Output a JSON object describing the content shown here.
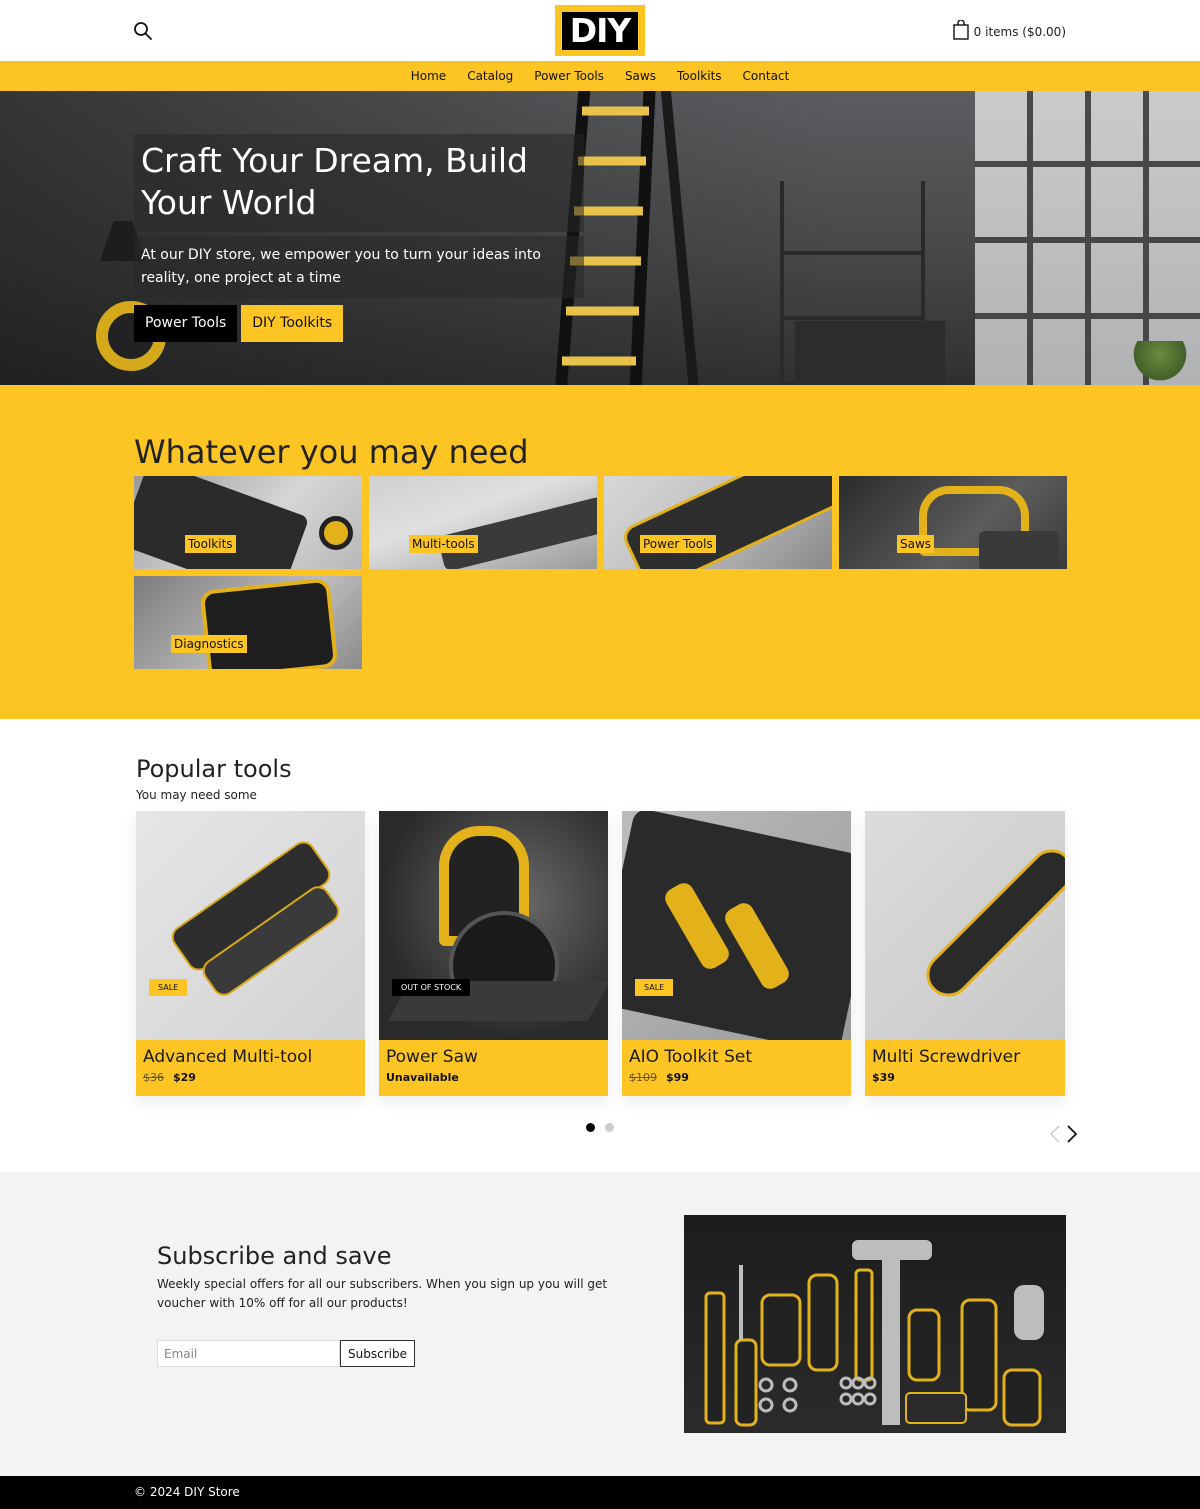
{
  "header": {
    "logo_text": "DIY",
    "search_icon": "search-icon",
    "cart_icon": "shopping-bag-icon",
    "cart_label": "0 items ($0.00)"
  },
  "nav": {
    "items": [
      {
        "label": "Home"
      },
      {
        "label": "Catalog"
      },
      {
        "label": "Power Tools"
      },
      {
        "label": "Saws"
      },
      {
        "label": "Toolkits"
      },
      {
        "label": "Contact"
      }
    ]
  },
  "hero": {
    "title": "Craft Your Dream, Build Your World",
    "subtitle": "At our DIY store, we empower you to turn your ideas into reality, one project at a time",
    "primary_button": "Power Tools",
    "secondary_button": "DIY Toolkits"
  },
  "categories": {
    "title": "Whatever you may need",
    "items": [
      {
        "label": "Toolkits"
      },
      {
        "label": "Multi-tools"
      },
      {
        "label": "Power Tools"
      },
      {
        "label": "Saws"
      },
      {
        "label": "Diagnostics"
      }
    ]
  },
  "popular": {
    "title": "Popular tools",
    "subtitle": "You may need some",
    "products": [
      {
        "name": "Advanced Multi-tool",
        "old_price": "$36",
        "price": "$29",
        "badge": "SALE"
      },
      {
        "name": "Power Saw",
        "status": "Unavailable",
        "badge": "OUT OF STOCK"
      },
      {
        "name": "AIO Toolkit Set",
        "old_price": "$109",
        "price": "$99",
        "badge": "SALE"
      },
      {
        "name": "Multi Screwdriver",
        "price": "$39"
      }
    ],
    "pagination": {
      "current": 1,
      "total": 2
    },
    "prev_icon": "chevron-left-icon",
    "next_icon": "chevron-right-icon"
  },
  "subscribe": {
    "title": "Subscribe and save",
    "text": "Weekly special offers for all our subscribers. When you sign up you will get voucher with 10% off for all our products!",
    "email_placeholder": "Email",
    "email_value": "",
    "button_label": "Subscribe"
  },
  "footer": {
    "copyright": "© 2024 DIY Store"
  },
  "colors": {
    "brand_yellow": "#fcc524",
    "black": "#000000",
    "subscribe_bg": "#f3f3f3"
  }
}
